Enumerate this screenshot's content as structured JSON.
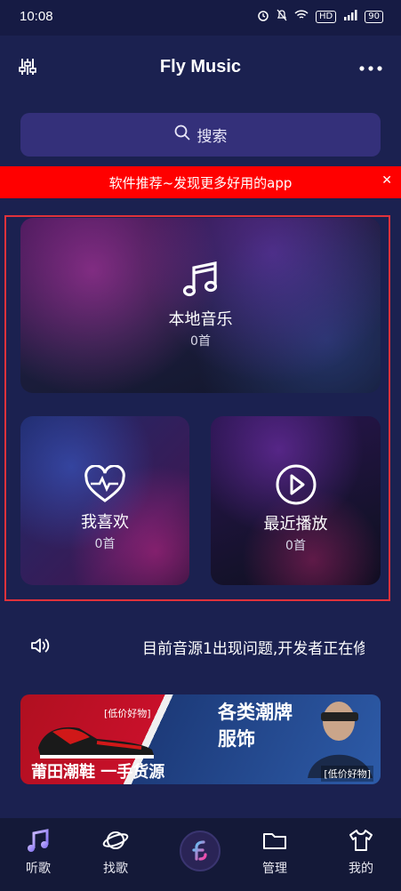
{
  "status_bar": {
    "time": "10:08",
    "battery": "90",
    "hd": "HD"
  },
  "header": {
    "title": "Fly Music"
  },
  "search": {
    "label": "搜索"
  },
  "promo_banner": {
    "text": "软件推荐~发现更多好用的app",
    "close": "✕"
  },
  "cards": {
    "local": {
      "label": "本地音乐",
      "count": "0首"
    },
    "favorites": {
      "label": "我喜欢",
      "count": "0首"
    },
    "recent": {
      "label": "最近播放",
      "count": "0首"
    }
  },
  "notice": {
    "text": "目前音源1出现问题,开发者正在修"
  },
  "ad": {
    "badge_left": "[低价好物]",
    "left_text": "莆田潮鞋  一手货源",
    "right_title_1": "各类潮牌",
    "right_title_2": "服饰",
    "badge_right": "[低价好物]"
  },
  "tabs": [
    {
      "label": "听歌",
      "icon": "music-note-icon"
    },
    {
      "label": "找歌",
      "icon": "planet-icon"
    },
    {
      "label": "",
      "icon": "app-logo-icon"
    },
    {
      "label": "管理",
      "icon": "folder-icon"
    },
    {
      "label": "我的",
      "icon": "tshirt-icon"
    }
  ],
  "colors": {
    "background": "#1b2150",
    "search_bg": "#34307a",
    "banner": "#ff0000",
    "frame": "#e0323b",
    "tabbar": "#141938"
  }
}
